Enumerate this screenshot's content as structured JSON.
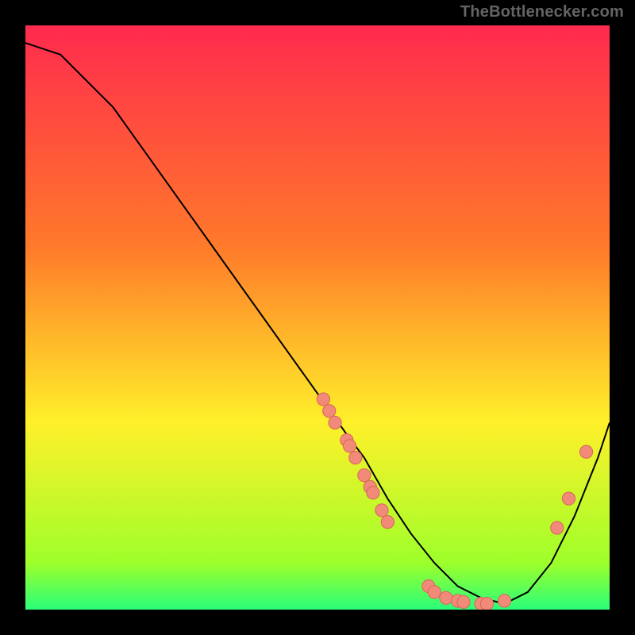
{
  "attribution": "TheBottlenecker.com",
  "colors": {
    "background": "#000000",
    "gradient_top": "#ff2a4e",
    "gradient_upper_mid": "#ff7a2a",
    "gradient_mid": "#fff02a",
    "gradient_lower_mid": "#9eff2a",
    "gradient_bottom": "#2aff7a",
    "curve": "#000000",
    "dot_fill": "#f28a7a",
    "dot_stroke": "#d96a5a",
    "attribution_text": "#646464"
  },
  "chart_data": {
    "type": "line",
    "title": "",
    "xlabel": "",
    "ylabel": "",
    "xlim": [
      0,
      100
    ],
    "ylim": [
      0,
      100
    ],
    "grid": false,
    "legend": false,
    "series": [
      {
        "name": "bottleneck-curve",
        "x": [
          0,
          3,
          6,
          10,
          15,
          20,
          25,
          30,
          35,
          40,
          45,
          50,
          55,
          58,
          62,
          66,
          70,
          74,
          78,
          82,
          86,
          90,
          94,
          98,
          100
        ],
        "y": [
          97,
          96,
          95,
          91,
          86,
          79,
          72,
          65,
          58,
          51,
          44,
          37,
          30,
          26,
          19,
          13,
          8,
          4,
          2,
          1,
          3,
          8,
          16,
          26,
          32
        ]
      }
    ],
    "markers": [
      {
        "x": 51,
        "y": 36
      },
      {
        "x": 52,
        "y": 34
      },
      {
        "x": 53,
        "y": 32
      },
      {
        "x": 55,
        "y": 29
      },
      {
        "x": 55.5,
        "y": 28
      },
      {
        "x": 56.5,
        "y": 26
      },
      {
        "x": 58,
        "y": 23
      },
      {
        "x": 59,
        "y": 21
      },
      {
        "x": 59.5,
        "y": 20
      },
      {
        "x": 61,
        "y": 17
      },
      {
        "x": 62,
        "y": 15
      },
      {
        "x": 69,
        "y": 4
      },
      {
        "x": 70,
        "y": 3
      },
      {
        "x": 72,
        "y": 2
      },
      {
        "x": 74,
        "y": 1.5
      },
      {
        "x": 75,
        "y": 1.3
      },
      {
        "x": 78,
        "y": 1
      },
      {
        "x": 79,
        "y": 1
      },
      {
        "x": 82,
        "y": 1.5
      },
      {
        "x": 91,
        "y": 14
      },
      {
        "x": 93,
        "y": 19
      },
      {
        "x": 96,
        "y": 27
      }
    ]
  }
}
